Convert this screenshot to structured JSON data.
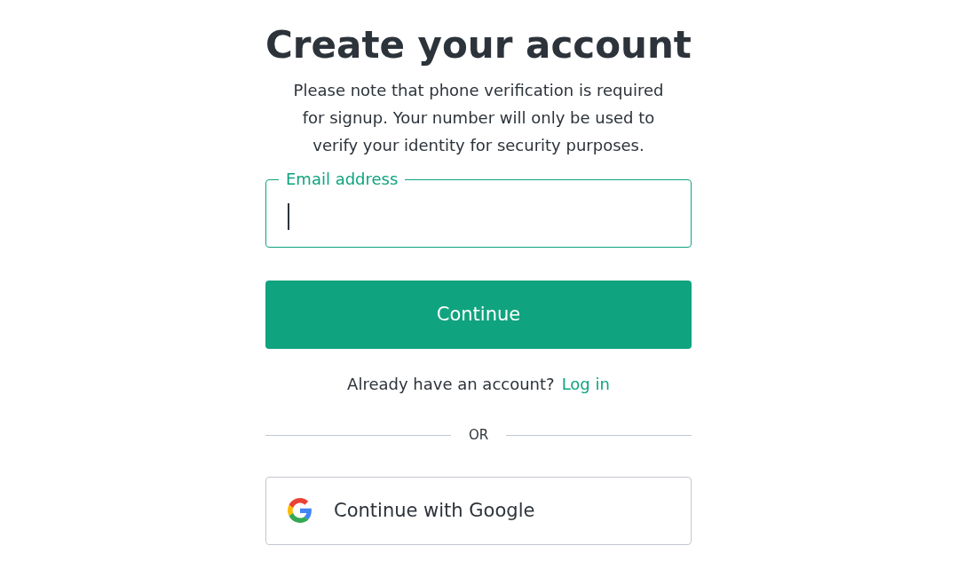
{
  "title": "Create your account",
  "description": "Please note that phone verification is required for signup. Your number will only be used to verify your identity for security purposes.",
  "email_field": {
    "label": "Email address",
    "focused": true
  },
  "continue_button": "Continue",
  "login_prompt": {
    "text": "Already have an account?",
    "link": "Log in"
  },
  "divider": "OR",
  "social_buttons": [
    {
      "kind": "google",
      "label": "Continue with Google"
    }
  ]
}
